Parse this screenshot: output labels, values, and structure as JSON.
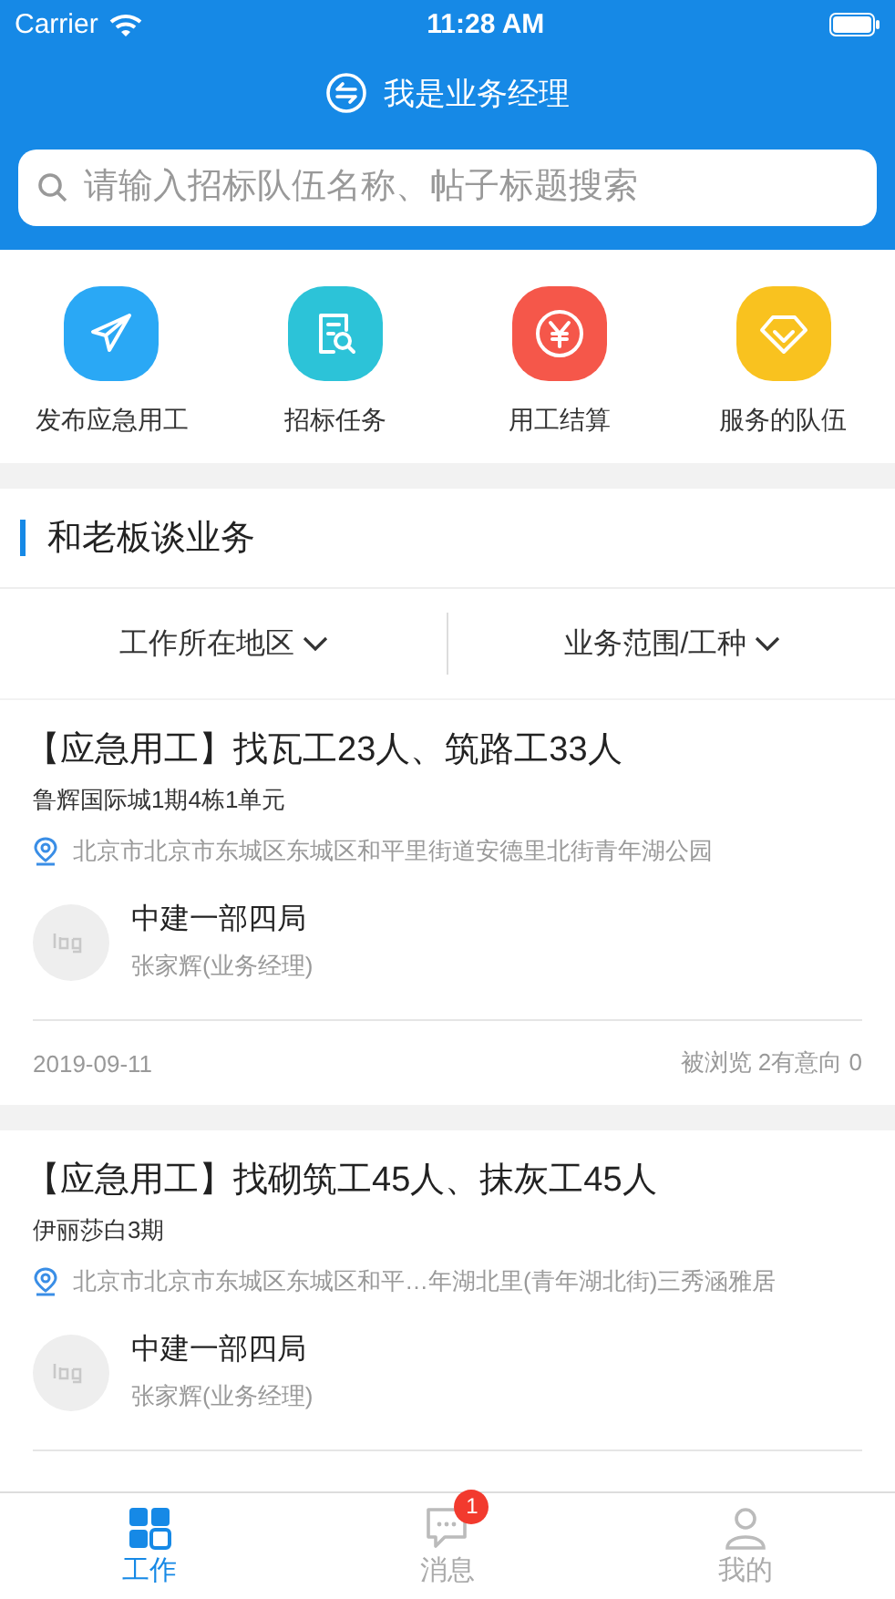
{
  "status_bar": {
    "carrier": "Carrier",
    "time": "11:28 AM"
  },
  "nav": {
    "title": "我是业务经理"
  },
  "search": {
    "placeholder": "请输入招标队伍名称、帖子标题搜索"
  },
  "shortcuts": [
    {
      "label": "发布应急用工",
      "kind": "send",
      "color": "#2aa8f5"
    },
    {
      "label": "招标任务",
      "kind": "document",
      "color": "#2cc3d8"
    },
    {
      "label": "用工结算",
      "kind": "yuan",
      "color": "#f5574a"
    },
    {
      "label": "服务的队伍",
      "kind": "gem",
      "color": "#f9c21f"
    }
  ],
  "section": {
    "title": "和老板谈业务"
  },
  "filters": [
    {
      "label": "工作所在地区"
    },
    {
      "label": "业务范围/工种"
    }
  ],
  "posts": [
    {
      "title": "【应急用工】找瓦工23人、筑路工33人",
      "project": "鲁辉国际城1期4栋1单元",
      "address": "北京市北京市东城区东城区和平里街道安德里北街青年湖公园",
      "company": "中建一部四局",
      "contact": "张家辉(业务经理)",
      "date": "2019-09-11",
      "stats": "被浏览 2有意向 0"
    },
    {
      "title": "【应急用工】找砌筑工45人、抹灰工45人",
      "project": "伊丽莎白3期",
      "address": "北京市北京市东城区东城区和平…年湖北里(青年湖北街)三秀涵雅居",
      "company": "中建一部四局",
      "contact": "张家辉(业务经理)"
    }
  ],
  "tab_bar": [
    {
      "label": "工作",
      "kind": "work",
      "selected": true
    },
    {
      "label": "消息",
      "kind": "message",
      "selected": false,
      "badge": "1"
    },
    {
      "label": "我的",
      "kind": "profile",
      "selected": false
    }
  ]
}
